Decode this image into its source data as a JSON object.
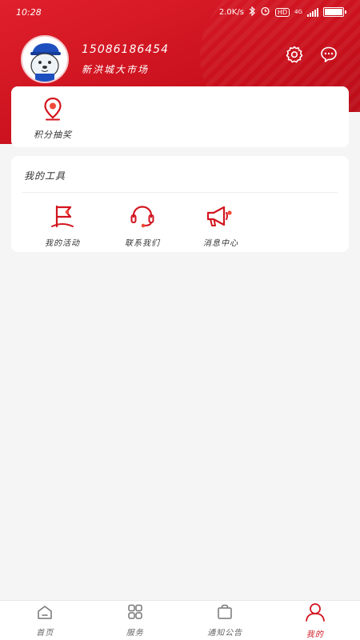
{
  "status_bar": {
    "time": "10:28",
    "speed": "2.0K/s",
    "hd": "HD",
    "net": "4G"
  },
  "profile": {
    "phone": "15086186454",
    "market": "新洪城大市场"
  },
  "header": {
    "settings_icon": "gear-icon",
    "message_icon": "chat-bubble-icon"
  },
  "points": {
    "label": "积分抽奖",
    "icon": "location-pin-icon"
  },
  "tools": {
    "title": "我的工具",
    "items": [
      {
        "label": "我的活动",
        "icon": "flag-icon"
      },
      {
        "label": "联系我们",
        "icon": "headset-icon"
      },
      {
        "label": "消息中心",
        "icon": "megaphone-icon"
      }
    ]
  },
  "tabbar": {
    "items": [
      {
        "label": "首页",
        "icon": "home-icon"
      },
      {
        "label": "服务",
        "icon": "grid-icon"
      },
      {
        "label": "通知公告",
        "icon": "bag-icon"
      },
      {
        "label": "我的",
        "icon": "user-icon"
      }
    ],
    "active": "我的"
  },
  "colors": {
    "brand_red": "#d2141f",
    "background": "#f5f5f5",
    "card": "#ffffff"
  }
}
